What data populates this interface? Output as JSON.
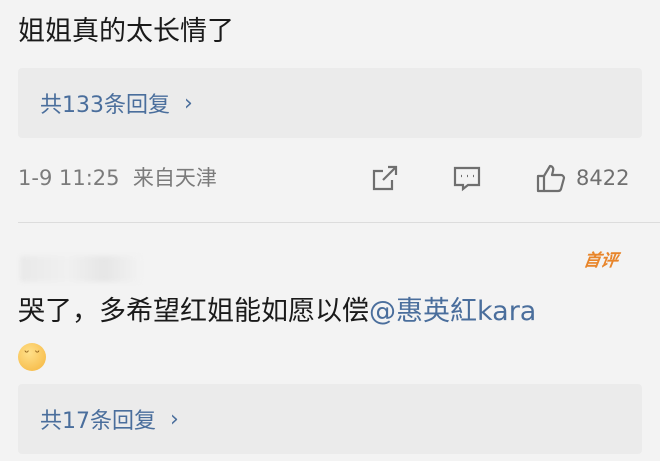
{
  "comment1": {
    "text": "姐姐真的太长情了",
    "replies_label": "共133条回复",
    "timestamp": "1-9 11:25",
    "source": "来自天津",
    "like_count": "8422"
  },
  "comment2": {
    "badge": "首评",
    "text": "哭了，多希望红姐能如愿以偿",
    "mention": "@惠英紅kara",
    "emoji_icon": "pensive-face-icon",
    "replies_label": "共17条回复"
  },
  "icons": {
    "chevron": "›",
    "share": "share-icon",
    "comment": "comment-icon",
    "like": "thumbs-up-icon"
  },
  "colors": {
    "link": "#4a6e9c",
    "badge": "#e8852a",
    "background": "#f3f3f3",
    "reply_box": "#ebebeb"
  }
}
